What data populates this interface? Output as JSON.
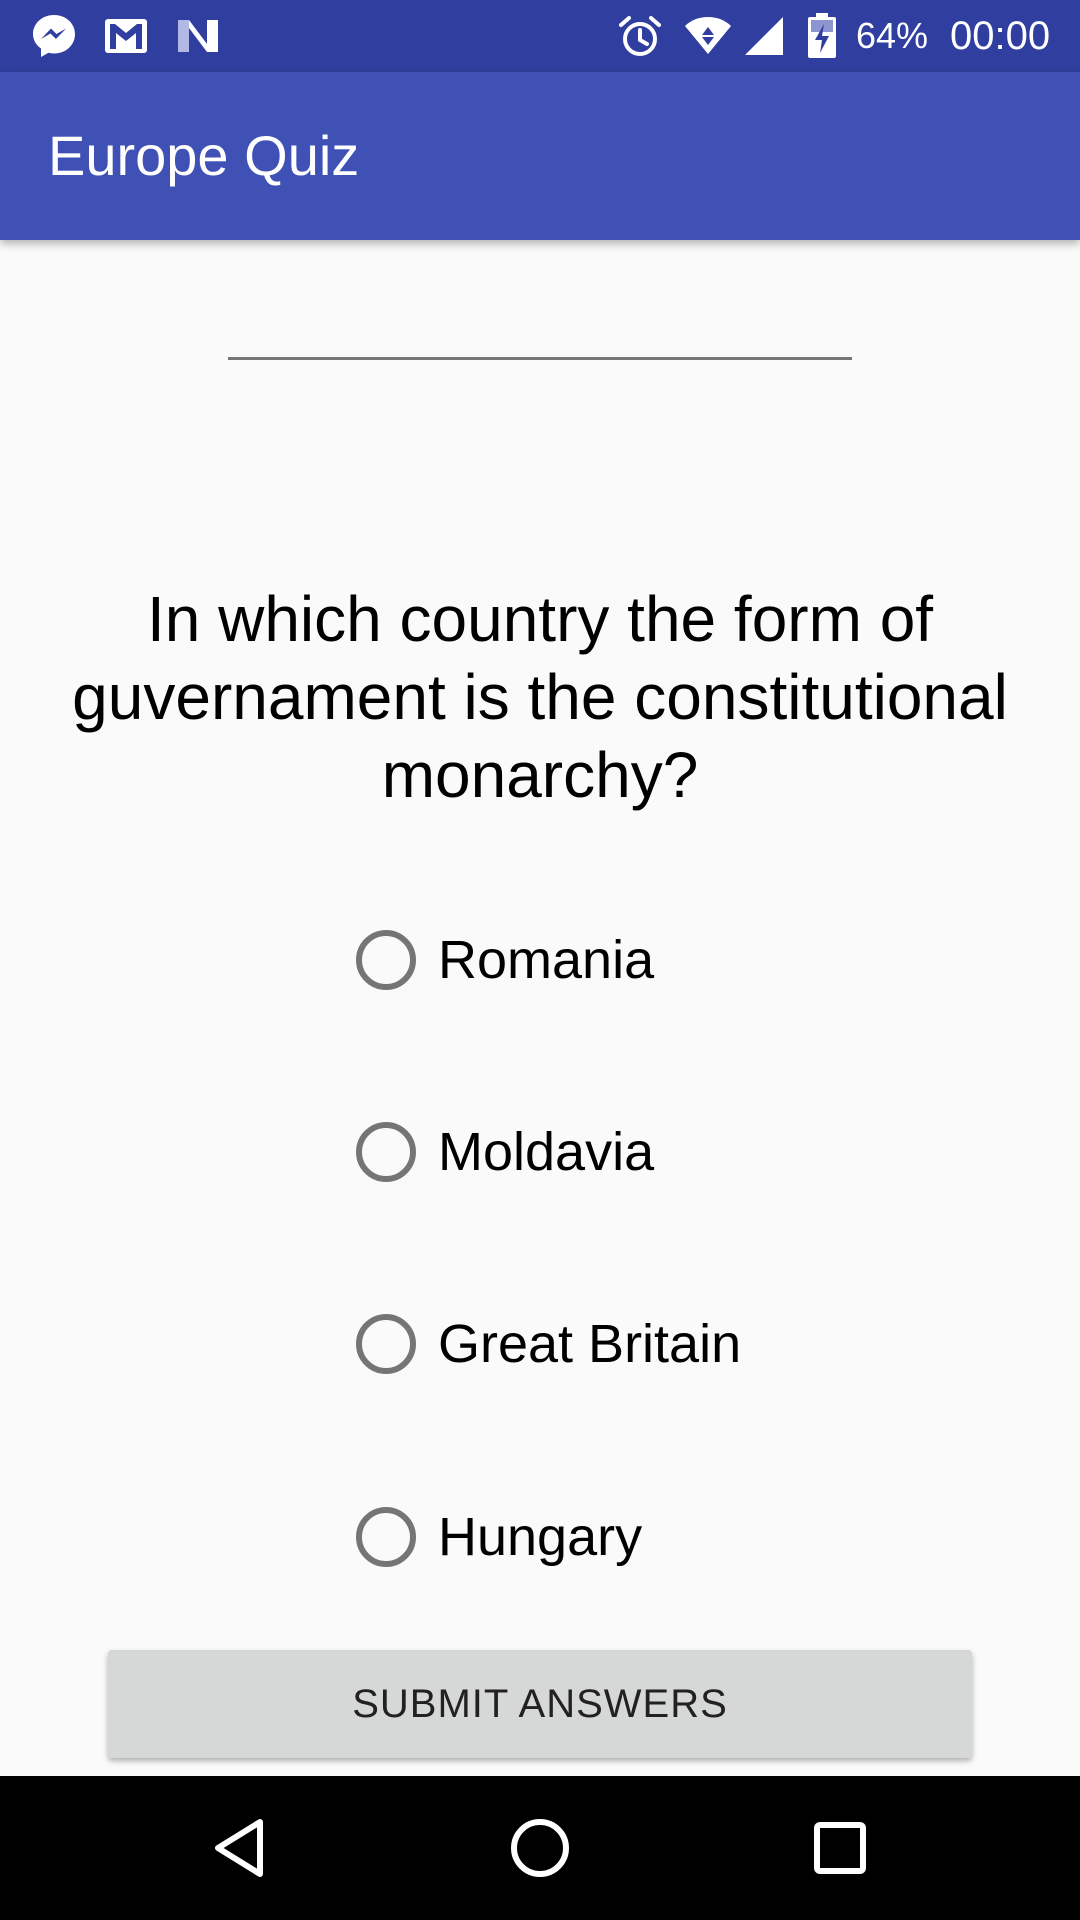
{
  "status_bar": {
    "notification_icons": [
      "messenger-icon",
      "gmail-icon",
      "n-app-icon"
    ],
    "system_icons": [
      "alarm-icon",
      "wifi-icon",
      "cell-signal-icon",
      "battery-charging-icon"
    ],
    "battery_percent": "64%",
    "time": "00:00",
    "background_color": "#303F9F"
  },
  "app_bar": {
    "title": "Europe Quiz",
    "background_color": "#3F51B5"
  },
  "name_field": {
    "value": "",
    "placeholder": ""
  },
  "question": {
    "text": "In which country the form of guvernament is the constitutional monarchy?"
  },
  "options": [
    {
      "label": "Romania",
      "selected": false
    },
    {
      "label": "Moldavia",
      "selected": false
    },
    {
      "label": "Great Britain",
      "selected": false
    },
    {
      "label": "Hungary",
      "selected": false
    }
  ],
  "submit_button": {
    "label": "SUBMIT ANSWERS"
  },
  "nav_bar": {
    "buttons": [
      "back-icon",
      "home-icon",
      "recents-icon"
    ]
  }
}
